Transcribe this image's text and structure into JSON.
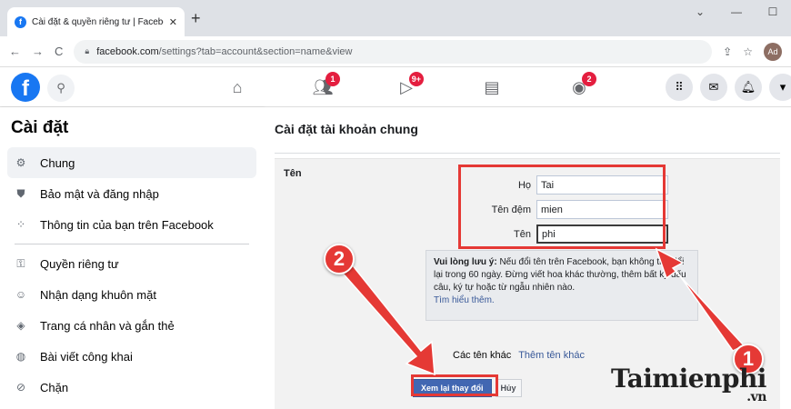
{
  "browser": {
    "tab_title": "Cài đặt & quyền riêng tư | Facebook",
    "tab_close": "✕",
    "new_tab": "+",
    "window_controls": [
      "⌄",
      "—",
      "☐"
    ],
    "url_host": "facebook.com",
    "url_path": "/settings?tab=account&section=name&view",
    "profile_initials": "Ad"
  },
  "fb": {
    "logo": "f",
    "badges": {
      "friends": "1",
      "watch": "9+",
      "groups": "2"
    }
  },
  "sidebar": {
    "title": "Cài đặt",
    "items": [
      {
        "label": "Chung",
        "icon": "gear-icon"
      },
      {
        "label": "Bảo mật và đăng nhập",
        "icon": "shield-icon"
      },
      {
        "label": "Thông tin của bạn trên Facebook",
        "icon": "grid-icon"
      },
      {
        "label": "Quyền riêng tư",
        "icon": "lock-icon"
      },
      {
        "label": "Nhận dạng khuôn mặt",
        "icon": "face-icon"
      },
      {
        "label": "Trang cá nhân và gắn thẻ",
        "icon": "tag-icon"
      },
      {
        "label": "Bài viết công khai",
        "icon": "globe-icon"
      },
      {
        "label": "Chặn",
        "icon": "block-user-icon"
      }
    ]
  },
  "main": {
    "title": "Cài đặt tài khoản chung",
    "section_label": "Tên",
    "fields": {
      "last_name_label": "Họ",
      "last_name_value": "Tai",
      "middle_name_label": "Tên đệm",
      "middle_name_value": "mien",
      "first_name_label": "Tên",
      "first_name_value": "phi"
    },
    "notice": {
      "bold": "Vui lòng lưu ý:",
      "text": "Nếu đổi tên trên Facebook, bạn không thể đổi lại trong 60 ngày. Đừng viết hoa khác thường, thêm bất kỳ dấu câu, ký tự hoặc từ ngẫu nhiên nào.",
      "link": "Tìm hiểu thêm."
    },
    "other_names_label": "Các tên khác",
    "other_names_link": "Thêm tên khác",
    "review_button": "Xem lại thay đổi",
    "cancel_button": "Hủy"
  },
  "annotations": {
    "marker_1": "1",
    "marker_2": "2",
    "accent": "#e53935"
  },
  "watermark": {
    "text": "Taimienphi",
    "suffix": ".vn"
  }
}
